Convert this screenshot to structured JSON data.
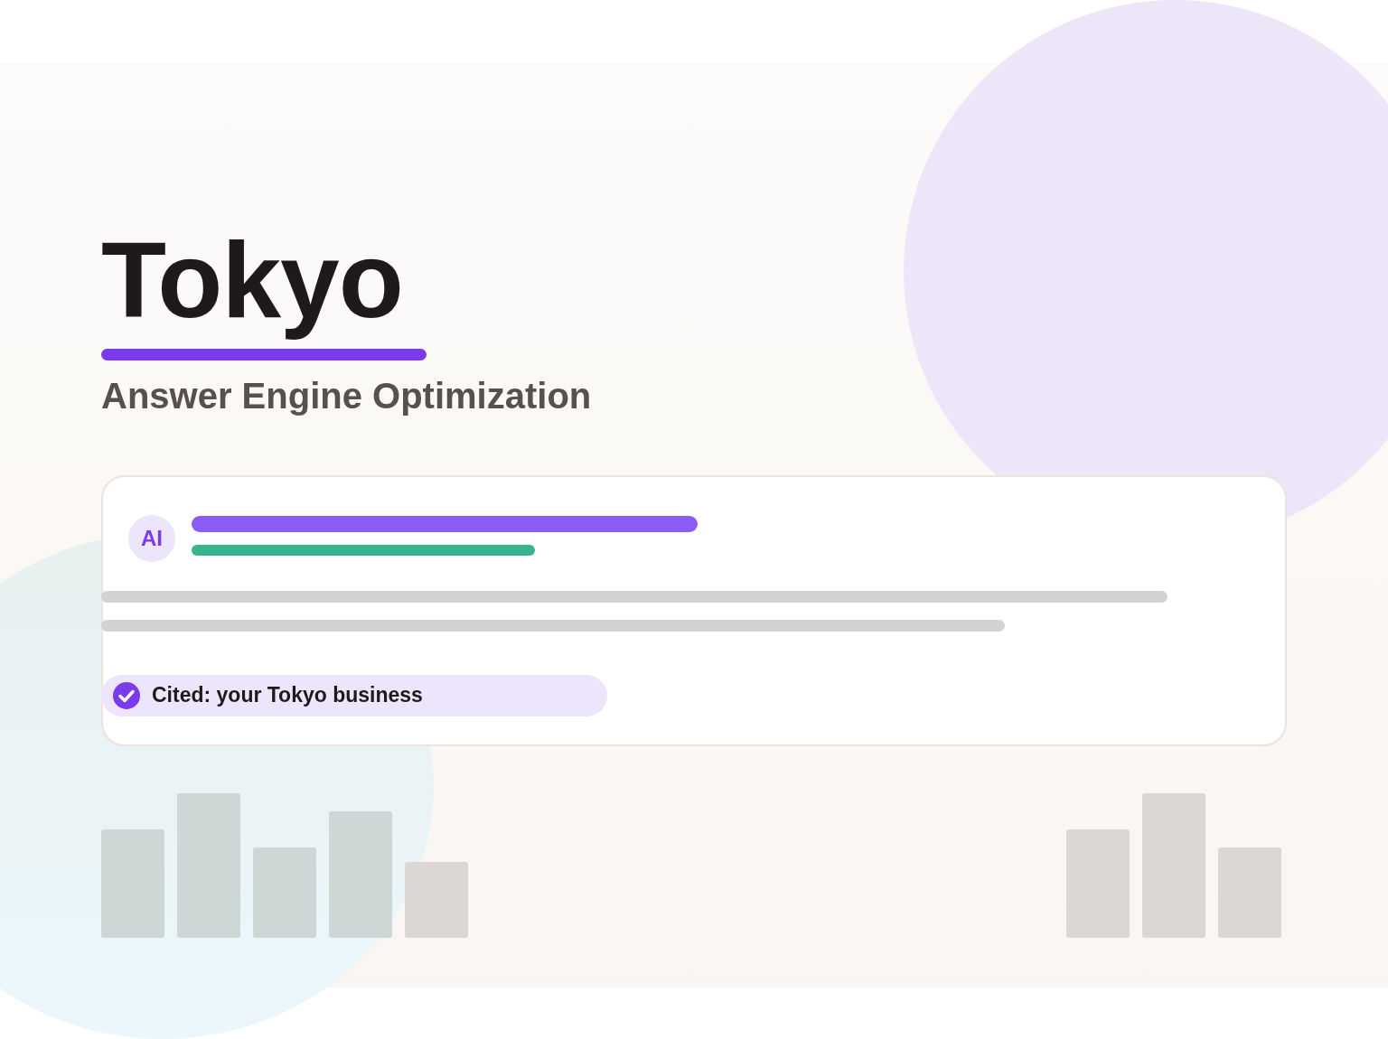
{
  "title": "Tokyo",
  "subtitle": "Answer Engine Optimization",
  "answer_card": {
    "avatar": "AI",
    "citation": "Cited: your Tokyo business"
  }
}
